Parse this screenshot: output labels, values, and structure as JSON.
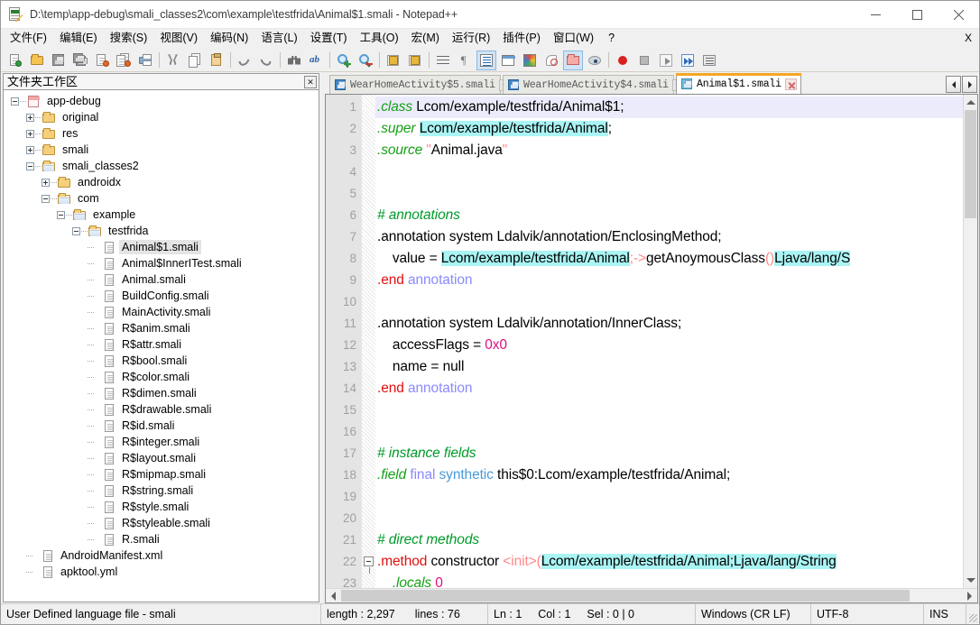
{
  "window": {
    "title": "D:\\temp\\app-debug\\smali_classes2\\com\\example\\testfrida\\Animal$1.smali - Notepad++",
    "app_icon": "notepad-plus-plus-icon",
    "minimize_label": "—",
    "maximize_label": "□",
    "close_label": "✕"
  },
  "menu": {
    "items": [
      {
        "label": "文件(F)",
        "name": "menu-file"
      },
      {
        "label": "编辑(E)",
        "name": "menu-edit"
      },
      {
        "label": "搜索(S)",
        "name": "menu-search"
      },
      {
        "label": "视图(V)",
        "name": "menu-view"
      },
      {
        "label": "编码(N)",
        "name": "menu-encoding"
      },
      {
        "label": "语言(L)",
        "name": "menu-language"
      },
      {
        "label": "设置(T)",
        "name": "menu-settings"
      },
      {
        "label": "工具(O)",
        "name": "menu-tools"
      },
      {
        "label": "宏(M)",
        "name": "menu-macro"
      },
      {
        "label": "运行(R)",
        "name": "menu-run"
      },
      {
        "label": "插件(P)",
        "name": "menu-plugins"
      },
      {
        "label": "窗口(W)",
        "name": "menu-window"
      },
      {
        "label": "?",
        "name": "menu-help"
      }
    ],
    "right_close": "X"
  },
  "toolbar": {
    "buttons": [
      "new-file-icon",
      "open-file-icon",
      "save-icon",
      "save-all-icon",
      "close-file-icon",
      "close-all-files-icon",
      "print-icon",
      "cut-icon",
      "copy-icon",
      "paste-icon",
      "undo-icon",
      "redo-icon",
      "find-icon",
      "replace-icon",
      "zoom-in-icon",
      "zoom-out-icon",
      "sync-vertical-scroll-icon",
      "sync-horizontal-scroll-icon",
      "word-wrap-icon",
      "show-all-characters-icon",
      "show-indent-guide-icon",
      "user-defined-dialog-icon",
      "document-map-icon",
      "function-list-icon",
      "folder-as-workspace-icon",
      "monitoring-icon",
      "record-macro-icon",
      "stop-record-macro-icon",
      "play-macro-icon",
      "run-macro-multiple-icon",
      "save-macro-icon"
    ]
  },
  "dock": {
    "title": "文件夹工作区",
    "close_icon": "close-icon",
    "tree": [
      {
        "label": "app-debug",
        "depth": 0,
        "expander": "minus",
        "icon": "root-project-icon",
        "selected": false
      },
      {
        "label": "original",
        "depth": 1,
        "expander": "plus",
        "icon": "folder-closed-icon",
        "selected": false
      },
      {
        "label": "res",
        "depth": 1,
        "expander": "plus",
        "icon": "folder-closed-icon",
        "selected": false
      },
      {
        "label": "smali",
        "depth": 1,
        "expander": "plus",
        "icon": "folder-closed-icon",
        "selected": false
      },
      {
        "label": "smali_classes2",
        "depth": 1,
        "expander": "minus",
        "icon": "folder-open-icon",
        "selected": false
      },
      {
        "label": "androidx",
        "depth": 2,
        "expander": "plus",
        "icon": "folder-closed-icon",
        "selected": false
      },
      {
        "label": "com",
        "depth": 2,
        "expander": "minus",
        "icon": "folder-open-icon",
        "selected": false
      },
      {
        "label": "example",
        "depth": 3,
        "expander": "minus",
        "icon": "folder-open-icon",
        "selected": false
      },
      {
        "label": "testfrida",
        "depth": 4,
        "expander": "minus",
        "icon": "folder-open-icon",
        "selected": false
      },
      {
        "label": "Animal$1.smali",
        "depth": 5,
        "expander": "none",
        "icon": "file-icon",
        "selected": true
      },
      {
        "label": "Animal$InnerITest.smali",
        "depth": 5,
        "expander": "none",
        "icon": "file-icon",
        "selected": false
      },
      {
        "label": "Animal.smali",
        "depth": 5,
        "expander": "none",
        "icon": "file-icon",
        "selected": false
      },
      {
        "label": "BuildConfig.smali",
        "depth": 5,
        "expander": "none",
        "icon": "file-icon",
        "selected": false
      },
      {
        "label": "MainActivity.smali",
        "depth": 5,
        "expander": "none",
        "icon": "file-icon",
        "selected": false
      },
      {
        "label": "R$anim.smali",
        "depth": 5,
        "expander": "none",
        "icon": "file-icon",
        "selected": false
      },
      {
        "label": "R$attr.smali",
        "depth": 5,
        "expander": "none",
        "icon": "file-icon",
        "selected": false
      },
      {
        "label": "R$bool.smali",
        "depth": 5,
        "expander": "none",
        "icon": "file-icon",
        "selected": false
      },
      {
        "label": "R$color.smali",
        "depth": 5,
        "expander": "none",
        "icon": "file-icon",
        "selected": false
      },
      {
        "label": "R$dimen.smali",
        "depth": 5,
        "expander": "none",
        "icon": "file-icon",
        "selected": false
      },
      {
        "label": "R$drawable.smali",
        "depth": 5,
        "expander": "none",
        "icon": "file-icon",
        "selected": false
      },
      {
        "label": "R$id.smali",
        "depth": 5,
        "expander": "none",
        "icon": "file-icon",
        "selected": false
      },
      {
        "label": "R$integer.smali",
        "depth": 5,
        "expander": "none",
        "icon": "file-icon",
        "selected": false
      },
      {
        "label": "R$layout.smali",
        "depth": 5,
        "expander": "none",
        "icon": "file-icon",
        "selected": false
      },
      {
        "label": "R$mipmap.smali",
        "depth": 5,
        "expander": "none",
        "icon": "file-icon",
        "selected": false
      },
      {
        "label": "R$string.smali",
        "depth": 5,
        "expander": "none",
        "icon": "file-icon",
        "selected": false
      },
      {
        "label": "R$style.smali",
        "depth": 5,
        "expander": "none",
        "icon": "file-icon",
        "selected": false
      },
      {
        "label": "R$styleable.smali",
        "depth": 5,
        "expander": "none",
        "icon": "file-icon",
        "selected": false
      },
      {
        "label": "R.smali",
        "depth": 5,
        "expander": "none",
        "icon": "file-icon",
        "selected": false
      },
      {
        "label": "AndroidManifest.xml",
        "depth": 1,
        "expander": "none",
        "icon": "file-icon",
        "selected": false
      },
      {
        "label": "apktool.yml",
        "depth": 1,
        "expander": "none",
        "icon": "file-icon",
        "selected": false
      }
    ]
  },
  "tabs": {
    "items": [
      {
        "label": "WearHomeActivity$5.smali",
        "active": false,
        "icon": "saved-file-icon",
        "close_icon": "close-icon"
      },
      {
        "label": "WearHomeActivity$4.smali",
        "active": false,
        "icon": "saved-file-icon",
        "close_icon": "close-icon"
      },
      {
        "label": "Animal$1.smali",
        "active": true,
        "icon": "saved-file-icon",
        "close_icon": "close-icon"
      }
    ],
    "scroll_left_icon": "arrow-left-icon",
    "scroll_right_icon": "arrow-right-icon"
  },
  "editor": {
    "first_visible_line": 1,
    "lines": [
      {
        "n": 1,
        "current": true,
        "fold": false,
        "spans": [
          {
            "t": ".class",
            "c": "k-directive"
          },
          {
            "t": " Lcom/example/testfrida/Animal$1;",
            "c": "k-plain"
          }
        ]
      },
      {
        "n": 2,
        "current": false,
        "fold": false,
        "spans": [
          {
            "t": ".super",
            "c": "k-directive"
          },
          {
            "t": " ",
            "c": "k-plain"
          },
          {
            "t": "Lcom/example/testfrida/Animal",
            "c": "k-plain hl-smart"
          },
          {
            "t": ";",
            "c": "k-plain"
          }
        ]
      },
      {
        "n": 3,
        "current": false,
        "fold": false,
        "spans": [
          {
            "t": ".source",
            "c": "k-directive"
          },
          {
            "t": " ",
            "c": "k-plain"
          },
          {
            "t": "\"",
            "c": "k-quote"
          },
          {
            "t": "Animal.java",
            "c": "k-string"
          },
          {
            "t": "\"",
            "c": "k-quote"
          }
        ]
      },
      {
        "n": 4,
        "current": false,
        "fold": false,
        "spans": []
      },
      {
        "n": 5,
        "current": false,
        "fold": false,
        "spans": []
      },
      {
        "n": 6,
        "current": false,
        "fold": false,
        "spans": [
          {
            "t": "# annotations",
            "c": "k-comment"
          }
        ]
      },
      {
        "n": 7,
        "current": false,
        "fold": false,
        "spans": [
          {
            "t": ".annotation system Ldalvik/annotation/EnclosingMethod;",
            "c": "k-plain"
          }
        ]
      },
      {
        "n": 8,
        "current": false,
        "fold": false,
        "spans": [
          {
            "t": "    value = ",
            "c": "k-plain"
          },
          {
            "t": "Lcom/example/testfrida/Animal",
            "c": "k-plain hl-smart"
          },
          {
            "t": ";->",
            "c": "k-punct"
          },
          {
            "t": "getAnoymousClass",
            "c": "k-plain"
          },
          {
            "t": "()",
            "c": "k-punct"
          },
          {
            "t": "Ljava/lang/S",
            "c": "k-plain hl-smart"
          }
        ]
      },
      {
        "n": 9,
        "current": false,
        "fold": false,
        "spans": [
          {
            "t": ".end",
            "c": "k-directive-red"
          },
          {
            "t": " ",
            "c": "k-plain"
          },
          {
            "t": "annotation",
            "c": "k-annotkw"
          }
        ]
      },
      {
        "n": 10,
        "current": false,
        "fold": false,
        "spans": []
      },
      {
        "n": 11,
        "current": false,
        "fold": false,
        "spans": [
          {
            "t": ".annotation system Ldalvik/annotation/InnerClass;",
            "c": "k-plain"
          }
        ]
      },
      {
        "n": 12,
        "current": false,
        "fold": false,
        "spans": [
          {
            "t": "    accessFlags = ",
            "c": "k-plain"
          },
          {
            "t": "0x0",
            "c": "k-number"
          }
        ]
      },
      {
        "n": 13,
        "current": false,
        "fold": false,
        "spans": [
          {
            "t": "    name = null",
            "c": "k-plain"
          }
        ]
      },
      {
        "n": 14,
        "current": false,
        "fold": false,
        "spans": [
          {
            "t": ".end",
            "c": "k-directive-red"
          },
          {
            "t": " ",
            "c": "k-plain"
          },
          {
            "t": "annotation",
            "c": "k-annotkw"
          }
        ]
      },
      {
        "n": 15,
        "current": false,
        "fold": false,
        "spans": []
      },
      {
        "n": 16,
        "current": false,
        "fold": false,
        "spans": []
      },
      {
        "n": 17,
        "current": false,
        "fold": false,
        "spans": [
          {
            "t": "# instance fields",
            "c": "k-comment"
          }
        ]
      },
      {
        "n": 18,
        "current": false,
        "fold": false,
        "spans": [
          {
            "t": ".field",
            "c": "k-directive"
          },
          {
            "t": " ",
            "c": "k-plain"
          },
          {
            "t": "final",
            "c": "k-modifier"
          },
          {
            "t": " ",
            "c": "k-plain"
          },
          {
            "t": "synthetic",
            "c": "k-modifier2"
          },
          {
            "t": " this$0:Lcom/example/testfrida/Animal;",
            "c": "k-plain"
          }
        ]
      },
      {
        "n": 19,
        "current": false,
        "fold": false,
        "spans": []
      },
      {
        "n": 20,
        "current": false,
        "fold": false,
        "spans": []
      },
      {
        "n": 21,
        "current": false,
        "fold": false,
        "spans": [
          {
            "t": "# direct methods",
            "c": "k-comment"
          }
        ]
      },
      {
        "n": 22,
        "current": false,
        "fold": true,
        "spans": [
          {
            "t": ".method",
            "c": "k-keyword-red"
          },
          {
            "t": " constructor ",
            "c": "k-plain"
          },
          {
            "t": "<init>",
            "c": "k-punct"
          },
          {
            "t": "(",
            "c": "k-punct"
          },
          {
            "t": "Lcom/example/testfrida/Animal;Ljava/lang/String",
            "c": "k-plain hl-smart"
          }
        ]
      },
      {
        "n": 23,
        "current": false,
        "fold": false,
        "spans": [
          {
            "t": "    .locals ",
            "c": "k-directive"
          },
          {
            "t": "0",
            "c": "k-number"
          }
        ]
      }
    ]
  },
  "statusbar": {
    "language": "User Defined language file - smali",
    "length_label": "length : 2,297",
    "lines_label": "lines : 76",
    "ln": "Ln : 1",
    "col": "Col : 1",
    "sel": "Sel : 0 | 0",
    "eol": "Windows (CR LF)",
    "encoding": "UTF-8",
    "insert_mode": "INS"
  },
  "colors": {
    "accent_tab": "#f5a623",
    "smart_highlight": "#aaf4f4",
    "current_line": "#ebebfb",
    "comment": "#009a2a",
    "directive": "#16a016",
    "keyword_red": "#e01010",
    "number": "#e01080",
    "punct": "#ff8888",
    "modifier": "#8a8aff"
  }
}
